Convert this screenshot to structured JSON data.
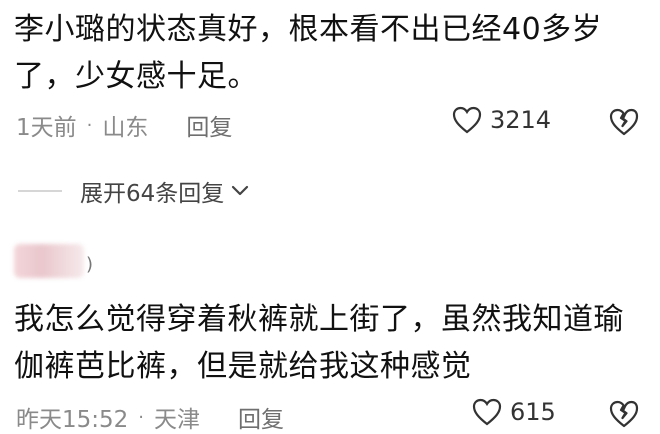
{
  "comments": [
    {
      "text": "李小璐的状态真好，根本看不出已经40多岁了，少女感十足。",
      "time": "1天前",
      "location": "山东",
      "reply_label": "回复",
      "likes": "3214"
    },
    {
      "text": "我怎么觉得穿着秋裤就上街了，虽然我知道瑜伽裤芭比裤，但是就给我这种感觉",
      "time": "昨天15:52",
      "location": "天津",
      "reply_label": "回复",
      "likes": "615",
      "username_stub": ")"
    }
  ],
  "expand_replies": {
    "label": "展开64条回复"
  },
  "meta_separator": "·",
  "icons": {
    "like": "heart-outline-icon",
    "dislike": "broken-heart-icon",
    "expand": "chevron-down-icon"
  },
  "colors": {
    "text": "#111111",
    "meta": "#8a8a8a",
    "avatar_blur": "#e9c7cc"
  }
}
